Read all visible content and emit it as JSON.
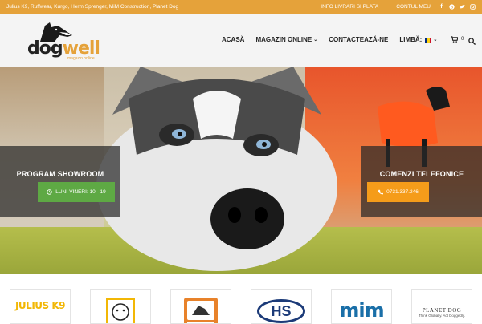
{
  "topbar": {
    "brands": "Julius K9, Ruffwear, Kurgo, Herm Sprenger, MiM Construction, Planet Dog",
    "links": [
      "INFO LIVRARI SI PLATA",
      "CONTUL MEU"
    ],
    "social_icons": [
      "facebook-icon",
      "pinterest-icon",
      "twitter-icon",
      "instagram-icon"
    ]
  },
  "logo": {
    "dog": "dog",
    "well": "well",
    "tagline": "magazin online"
  },
  "nav": {
    "items": [
      "ACASĂ",
      "MAGAZIN ONLINE",
      "CONTACTEAZĂ-NE",
      "LIMBĂ:"
    ],
    "cart_count": "0"
  },
  "hero": {
    "left_title": "PROGRAM SHOWROOM",
    "left_button": "LUNI-VINERI: 10 - 19",
    "right_title": "COMENZI TELEFONICE",
    "right_button": "0731.337.246"
  },
  "brand_logos": {
    "julius": "JULIUS K9",
    "hs": "HS",
    "mim": "mim",
    "planetdog": "PLANET DOG",
    "planetdog_tag": "Think Globally. Act Doggedly."
  },
  "colors": {
    "accent": "#e5a23a",
    "green": "#5ea944",
    "orange": "#f59c1a"
  }
}
